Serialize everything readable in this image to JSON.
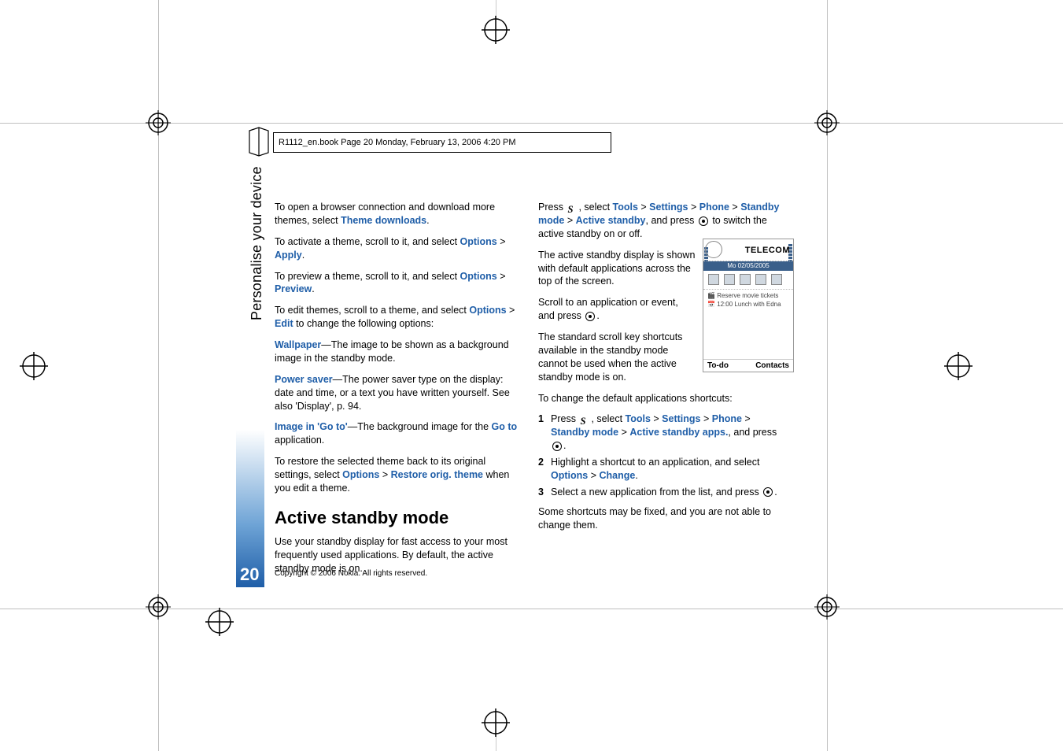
{
  "header_line": "R1112_en.book  Page 20  Monday, February 13, 2006  4:20 PM",
  "sidebar_title": "Personalise your device",
  "page_number": "20",
  "copyright": "Copyright © 2006 Nokia. All rights reserved.",
  "col1": {
    "p1_a": "To open a browser connection and download more themes, select ",
    "p1_link": "Theme downloads",
    "p1_b": ".",
    "p2_a": "To activate a theme, scroll to it, and select ",
    "p2_link1": "Options",
    "p2_sep": " > ",
    "p2_link2": "Apply",
    "p2_b": ".",
    "p3_a": "To preview a theme, scroll to it, and select ",
    "p3_link1": "Options",
    "p3_link2": "Preview",
    "p3_b": ".",
    "p4_a": "To edit themes, scroll to a theme, and select ",
    "p4_link1": "Options",
    "p4_link2": "Edit",
    "p4_b": " to change the following options:",
    "p5_link": "Wallpaper",
    "p5_a": "—The image to be shown as a background image in the standby mode.",
    "p6_link": "Power saver",
    "p6_a": "—The power saver type on the display: date and time, or a text you have written yourself. See also 'Display', p. 94.",
    "p7_link": "Image in 'Go to'",
    "p7_a": "—The background image for the ",
    "p7_link2": "Go to",
    "p7_b": " application.",
    "p8_a": "To restore the selected theme back to its original settings, select ",
    "p8_link1": "Options",
    "p8_link2": "Restore orig. theme",
    "p8_b": " when you edit a theme.",
    "h2": "Active standby mode",
    "p9": "Use your standby display for fast access to your most frequently used applications. By default, the active standby mode is on."
  },
  "col2": {
    "p1_a": "Press ",
    "p1_b": ", select ",
    "p1_l1": "Tools",
    "p1_l2": "Settings",
    "p1_l3": "Phone",
    "p1_l4": "Standby mode",
    "p1_l5": "Active standby",
    "p1_c": ", and press ",
    "p1_d": " to switch the active standby on or off.",
    "p2": "The active standby display is shown with default applications across the top of the screen.",
    "p3_a": "Scroll to an application or event, and press ",
    "p3_b": ".",
    "p4": "The standard scroll key shortcuts available in the standby mode cannot be used when the active standby mode is on.",
    "p5": "To change the default applications shortcuts:",
    "li1_a": "Press ",
    "li1_b": ", select ",
    "li1_l1": "Tools",
    "li1_l2": "Settings",
    "li1_l3": "Phone",
    "li1_l4": "Standby mode",
    "li1_l5": "Active standby apps.",
    "li1_c": ", and press ",
    "li1_d": ".",
    "li2_a": "Highlight a shortcut to an application, and select ",
    "li2_l1": "Options",
    "li2_l2": "Change",
    "li2_b": ".",
    "li3_a": "Select a new application from the list, and press ",
    "li3_b": ".",
    "p6": "Some shortcuts may be fixed, and you are not able to change them."
  },
  "phone": {
    "operator": "TELECOM",
    "date": "Mo 02/05/2005",
    "line1": "Reserve movie tickets",
    "line2": "12:00 Lunch with Edna",
    "soft_left": "To-do",
    "soft_right": "Contacts"
  },
  "sep": " > ",
  "num1": "1",
  "num2": "2",
  "num3": "3"
}
